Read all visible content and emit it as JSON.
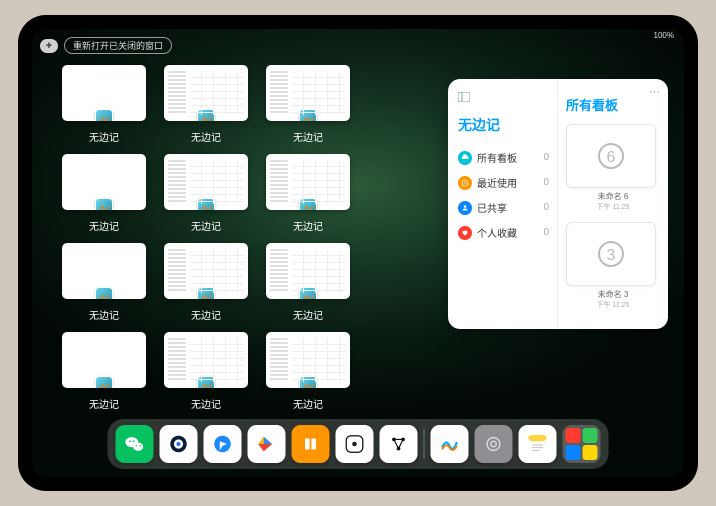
{
  "statusbar": {
    "text": "100%"
  },
  "topbar": {
    "plus": "+",
    "reopen_label": "重新打开已关闭的窗口"
  },
  "app_name": "无边记",
  "windows": [
    [
      {
        "type": "blank"
      },
      {
        "type": "content"
      },
      {
        "type": "content"
      }
    ],
    [
      {
        "type": "blank"
      },
      {
        "type": "content"
      },
      {
        "type": "content"
      }
    ],
    [
      {
        "type": "blank"
      },
      {
        "type": "content"
      },
      {
        "type": "content"
      }
    ],
    [
      {
        "type": "blank"
      },
      {
        "type": "content"
      },
      {
        "type": "content"
      }
    ]
  ],
  "panel": {
    "left_title": "无边记",
    "nav": [
      {
        "icon": "cloud",
        "color": "#00c2d9",
        "label": "所有看板",
        "count": 0
      },
      {
        "icon": "recent",
        "color": "#ff9500",
        "label": "最近使用",
        "count": 0
      },
      {
        "icon": "shared",
        "color": "#0a84ff",
        "label": "已共享",
        "count": 0
      },
      {
        "icon": "heart",
        "color": "#ff3b30",
        "label": "个人收藏",
        "count": 0
      }
    ],
    "right_title": "所有看板",
    "boards": [
      {
        "digit": "6",
        "name": "未命名 6",
        "time": "下午 11:25"
      },
      {
        "digit": "3",
        "name": "未命名 3",
        "time": "下午 11:25"
      }
    ]
  },
  "dock": [
    {
      "name": "wechat",
      "bg": "#07c160"
    },
    {
      "name": "iqiyi",
      "bg": "#ffffff"
    },
    {
      "name": "browser",
      "bg": "#ffffff"
    },
    {
      "name": "play-video",
      "bg": "#ffffff"
    },
    {
      "name": "books",
      "bg": "#ff9500"
    },
    {
      "name": "dice",
      "bg": "#ffffff"
    },
    {
      "name": "nodes",
      "bg": "#ffffff"
    },
    {
      "name": "freeform",
      "bg": "#ffffff"
    },
    {
      "name": "settings",
      "bg": "#8e8e93"
    },
    {
      "name": "notes",
      "bg": "#ffffff"
    }
  ]
}
